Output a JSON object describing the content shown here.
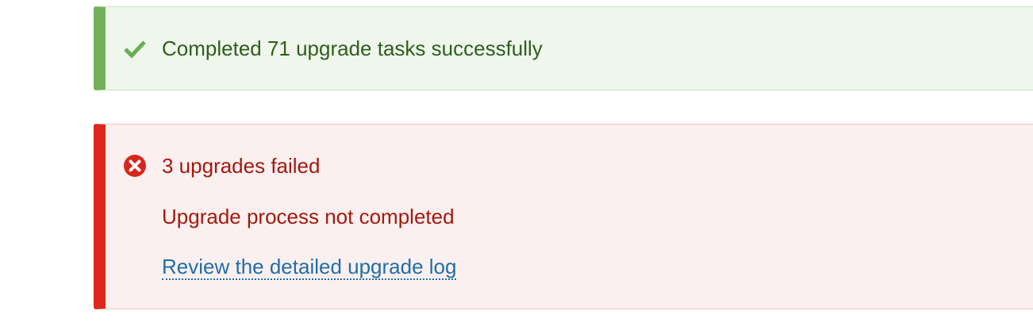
{
  "success_alert": {
    "icon": "checkmark-icon",
    "message": "Completed 71 upgrade tasks successfully",
    "accent_color": "#72b15a"
  },
  "error_alert": {
    "icon": "error-circle-icon",
    "title": "3 upgrades failed",
    "subtitle": "Upgrade process not completed",
    "link_label": "Review the detailed upgrade log",
    "accent_color": "#e1261c"
  }
}
